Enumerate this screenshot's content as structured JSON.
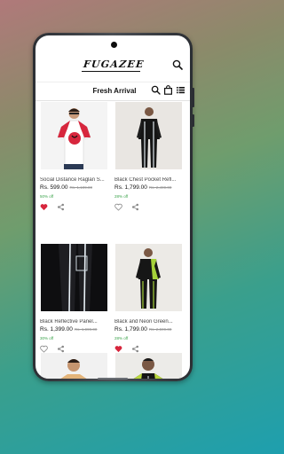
{
  "app": {
    "logo_text": "FUGAZEE",
    "section_title": "Fresh Arrival",
    "accent_color": "#d7263d",
    "discount_color": "#3aa34a"
  },
  "icons": {
    "header_search": "search-icon",
    "sub_search": "search-icon",
    "cart": "shopping-bag-icon",
    "view": "list-view-icon",
    "wishlist": "heart-icon",
    "share": "share-icon"
  },
  "products": [
    {
      "name": "Social Distance Raglan S...",
      "price": "Rs. 599.00",
      "mrp": "Rs. 1,199.00",
      "off": "50% off",
      "wishlisted": true
    },
    {
      "name": "Black Chest Pocket Refl...",
      "price": "Rs. 1,799.00",
      "mrp": "Rs. 2,499.00",
      "off": "28% off",
      "wishlisted": false
    },
    {
      "name": "Black Reflective Panel...",
      "price": "Rs. 1,399.00",
      "mrp": "Rs. 1,999.00",
      "off": "30% off",
      "wishlisted": false
    },
    {
      "name": "Black and Neon Green...",
      "price": "Rs. 1,799.00",
      "mrp": "Rs. 2,599.00",
      "off": "28% off",
      "wishlisted": true
    },
    {
      "name": "",
      "price": "",
      "mrp": "",
      "off": "",
      "wishlisted": false
    },
    {
      "name": "",
      "price": "",
      "mrp": "",
      "off": "",
      "wishlisted": false
    }
  ]
}
